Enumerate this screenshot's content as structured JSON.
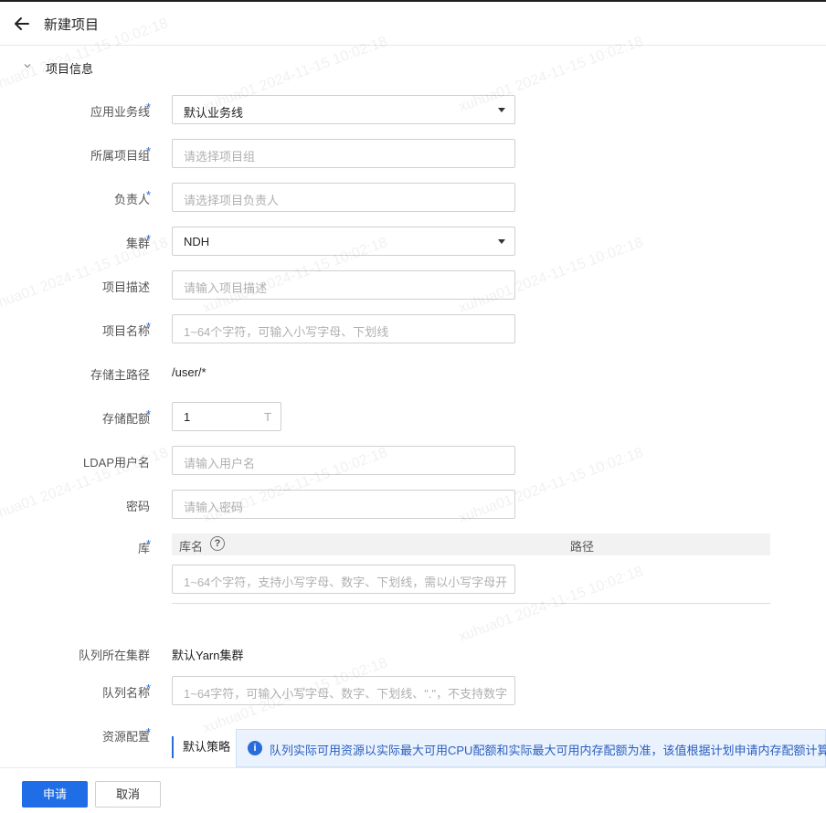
{
  "header": {
    "title": "新建项目"
  },
  "section": {
    "title": "项目信息"
  },
  "form": {
    "business_line": {
      "label": "应用业务线",
      "value": "默认业务线"
    },
    "project_group": {
      "label": "所属项目组",
      "placeholder": "请选择项目组"
    },
    "owner": {
      "label": "负责人",
      "placeholder": "请选择项目负责人"
    },
    "cluster": {
      "label": "集群",
      "value": "NDH"
    },
    "description": {
      "label": "项目描述",
      "placeholder": "请输入项目描述"
    },
    "project_name": {
      "label": "项目名称",
      "placeholder": "1~64个字符，可输入小写字母、下划线"
    },
    "storage_path": {
      "label": "存储主路径",
      "value": "/user/*"
    },
    "storage_quota": {
      "label": "存储配额",
      "value": "1",
      "unit": "T"
    },
    "ldap_user": {
      "label": "LDAP用户名",
      "placeholder": "请输入用户名"
    },
    "password": {
      "label": "密码",
      "placeholder": "请输入密码"
    },
    "library": {
      "label": "库",
      "col_name": "库名",
      "col_path": "路径",
      "placeholder": "1~64个字符，支持小写字母、数字、下划线，需以小写字母开头"
    },
    "queue_cluster": {
      "label": "队列所在集群",
      "value": "默认Yarn集群"
    },
    "queue_name": {
      "label": "队列名称",
      "placeholder": "1~64字符，可输入小写字母、数字、下划线、\".\"，不支持数字开头"
    },
    "resource": {
      "label": "资源配置",
      "strategy": "默认策略",
      "info": "队列实际可用资源以实际最大可用CPU配额和实际最大可用内存配额为准，该值根据计划申请内存配额计算得到。"
    }
  },
  "footer": {
    "submit": "申请",
    "cancel": "取消"
  },
  "required_mark": "*",
  "watermark": "xuhua01 2024-11-15 10:02:18",
  "colors": {
    "accent": "#1f6ee8",
    "info_bg": "#eaf2fd"
  }
}
